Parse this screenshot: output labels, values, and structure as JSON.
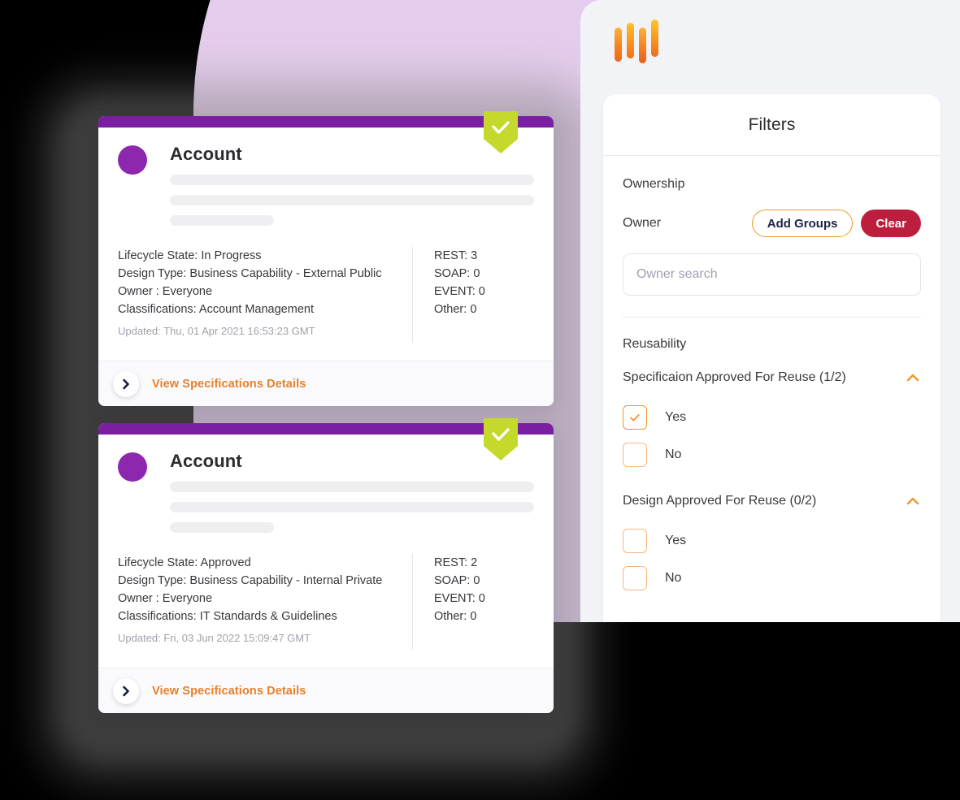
{
  "brand": {
    "logo_name": "orange-bars-logo"
  },
  "filters": {
    "title": "Filters",
    "ownership": {
      "section_label": "Ownership",
      "owner_label": "Owner",
      "add_groups_label": "Add Groups",
      "clear_label": "Clear",
      "search_placeholder": "Owner search",
      "search_value": ""
    },
    "reusability": {
      "section_label": "Reusability",
      "groups": [
        {
          "title": "Specificaion Approved For Reuse (1/2)",
          "collapse_state": "expanded",
          "options": [
            {
              "label": "Yes",
              "checked": true
            },
            {
              "label": "No",
              "checked": false
            }
          ]
        },
        {
          "title": "Design Approved For Reuse (0/2)",
          "collapse_state": "expanded",
          "options": [
            {
              "label": "Yes",
              "checked": false
            },
            {
              "label": "No",
              "checked": false
            }
          ]
        }
      ]
    }
  },
  "cards": [
    {
      "title": "Account",
      "badge": "approved-check-badge",
      "lifecycle_state": "Lifecycle State: In Progress",
      "design_type": "Design Type: Business Capability - External Public",
      "owner": "Owner : Everyone",
      "classifications": "Classifications: Account Management",
      "updated": "Updated: Thu, 01 Apr 2021 16:53:23 GMT",
      "counts": [
        "REST: 3",
        "SOAP: 0",
        "EVENT: 0",
        "Other: 0"
      ],
      "footer_link": "View Specifications Details"
    },
    {
      "title": "Account",
      "badge": "approved-check-badge",
      "lifecycle_state": "Lifecycle State: Approved",
      "design_type": "Design Type: Business Capability - Internal Private",
      "owner": "Owner : Everyone",
      "classifications": "Classifications: IT Standards & Guidelines",
      "updated": "Updated: Fri, 03 Jun 2022 15:09:47 GMT",
      "counts": [
        "REST: 2",
        "SOAP: 0",
        "EVENT: 0",
        "Other: 0"
      ],
      "footer_link": "View Specifications Details"
    }
  ],
  "colors": {
    "purple": "#7A1FA2",
    "avatar_purple": "#8C27AE",
    "badge_green": "#C5D92D",
    "orange": "#F0962A",
    "link_orange": "#E8802A",
    "clear_red": "#BE1E3E",
    "panel_bg": "#F2F3F7",
    "blob_purple": "#E4CDEC"
  }
}
